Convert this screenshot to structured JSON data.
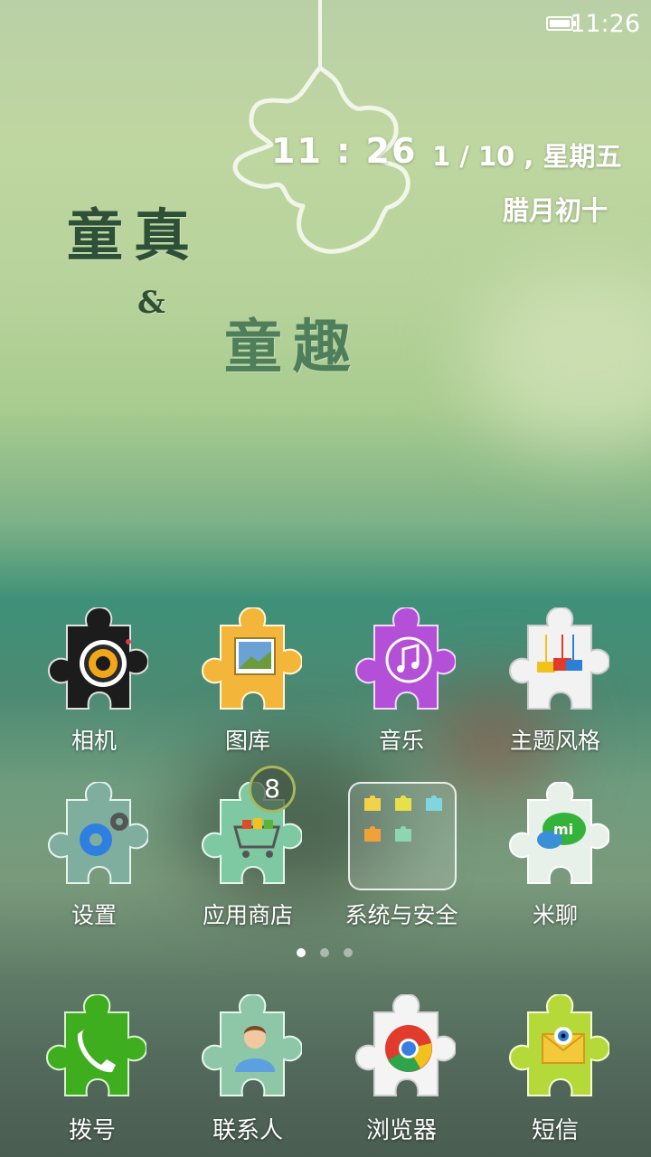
{
  "status_bar": {
    "time": "11:26",
    "battery_icon": "battery-full-icon"
  },
  "widget": {
    "clock_time": "11 : 26",
    "date": "1 / 10 , 星期五",
    "lunar_date": "腊月初十",
    "text_line1": "童真",
    "text_amp": "&",
    "text_line2": "童趣"
  },
  "apps_row1": [
    {
      "label": "相机",
      "icon": "camera-puzzle-icon"
    },
    {
      "label": "图库",
      "icon": "gallery-puzzle-icon"
    },
    {
      "label": "音乐",
      "icon": "music-puzzle-icon"
    },
    {
      "label": "主题风格",
      "icon": "themes-puzzle-icon"
    }
  ],
  "apps_row2": [
    {
      "label": "设置",
      "icon": "settings-puzzle-icon"
    },
    {
      "label": "应用商店",
      "icon": "app-store-puzzle-icon",
      "badge": "8"
    },
    {
      "label": "系统与安全",
      "icon": "folder-icon"
    },
    {
      "label": "米聊",
      "icon": "miliao-puzzle-icon"
    }
  ],
  "page_indicator": {
    "pages": 3,
    "current": 1
  },
  "dock": [
    {
      "label": "拨号",
      "icon": "phone-puzzle-icon"
    },
    {
      "label": "联系人",
      "icon": "contacts-puzzle-icon"
    },
    {
      "label": "浏览器",
      "icon": "browser-puzzle-icon"
    },
    {
      "label": "短信",
      "icon": "messages-puzzle-icon"
    }
  ],
  "colors": {
    "camera": "#1b1b1b",
    "gallery": "#f4b63a",
    "music": "#b74ad6",
    "themes": "#f2f2f2",
    "settings": "#7fae9e",
    "store": "#7fc9a2",
    "miliao": "#e8f0ea",
    "phone": "#3fae1e",
    "contacts": "#8ec7a8",
    "browser": "#f4f4f4",
    "messages": "#b6d93a"
  }
}
